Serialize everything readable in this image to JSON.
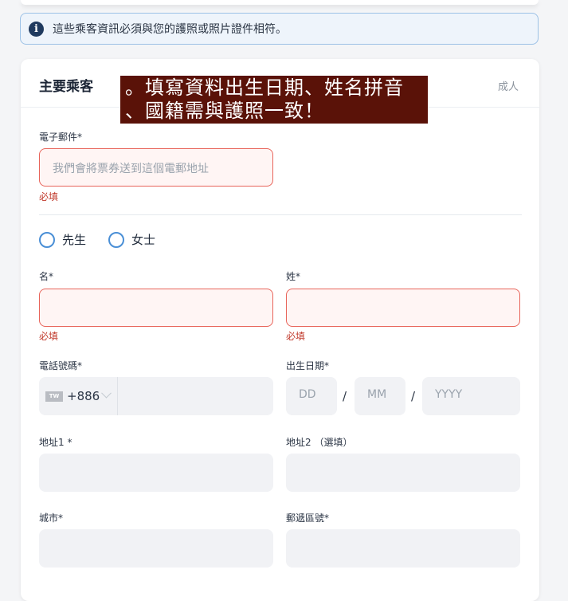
{
  "notice": {
    "icon": "info-icon",
    "text": "這些乘客資訊必須與您的護照或照片證件相符。"
  },
  "card": {
    "title": "主要乘客",
    "passenger_type": "成人"
  },
  "overlay": {
    "line1": "。填寫資料出生日期、姓名拼音",
    "line2": "、國籍需與護照一致！"
  },
  "email": {
    "label": "電子郵件*",
    "placeholder": "我們會將票券送到這個電郵地址",
    "error": "必填"
  },
  "gender": {
    "options": [
      "先生",
      "女士"
    ]
  },
  "first_name": {
    "label": "名*",
    "error": "必填"
  },
  "last_name": {
    "label": "姓*",
    "error": "必填"
  },
  "phone": {
    "label": "電話號碼*",
    "country_code": "TW",
    "dial_code": "+886"
  },
  "birth_date": {
    "label": "出生日期*",
    "day_placeholder": "DD",
    "month_placeholder": "MM",
    "year_placeholder": "YYYY",
    "separator": "/"
  },
  "address1": {
    "label": "地址1 *"
  },
  "address2": {
    "label": "地址2 （選填）"
  },
  "city": {
    "label": "城市*"
  },
  "postal_code": {
    "label": "郵遞區號*"
  }
}
